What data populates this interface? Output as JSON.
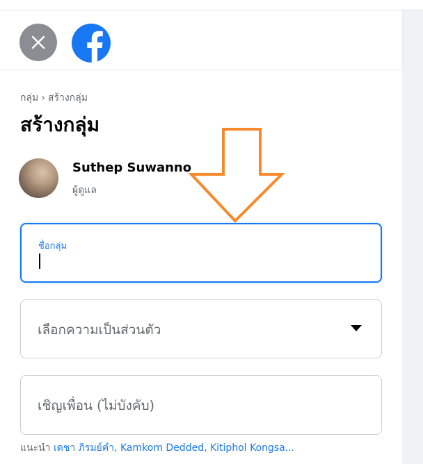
{
  "breadcrumb": {
    "groups": "กลุ่ม",
    "separator": "›",
    "create": "สร้างกลุ่ม"
  },
  "page": {
    "title": "สร้างกลุ่ม"
  },
  "user": {
    "name": "Suthep Suwanno",
    "role": "ผู้ดูแล"
  },
  "form": {
    "group_name": {
      "label": "ชื่อกลุ่ม",
      "value": ""
    },
    "privacy": {
      "placeholder": "เลือกความเป็นส่วนตัว"
    },
    "invite": {
      "placeholder": "เชิญเพื่อน (ไม่บังคับ)"
    }
  },
  "suggestions": {
    "prefix": "แนะนำ",
    "names": "เดชา ภิรมย์คำ, Kamkom Dedded, Kitiphol Kongsa..."
  },
  "icons": {
    "close": "close-icon",
    "logo": "facebook-logo-icon",
    "dropdown": "caret-down-icon",
    "arrow": "arrow-down-annotation"
  },
  "colors": {
    "accent": "#1877f2",
    "annotation": "#f6892b",
    "close_bg": "#8a8d91",
    "panel_bg": "#f0f2f5"
  }
}
